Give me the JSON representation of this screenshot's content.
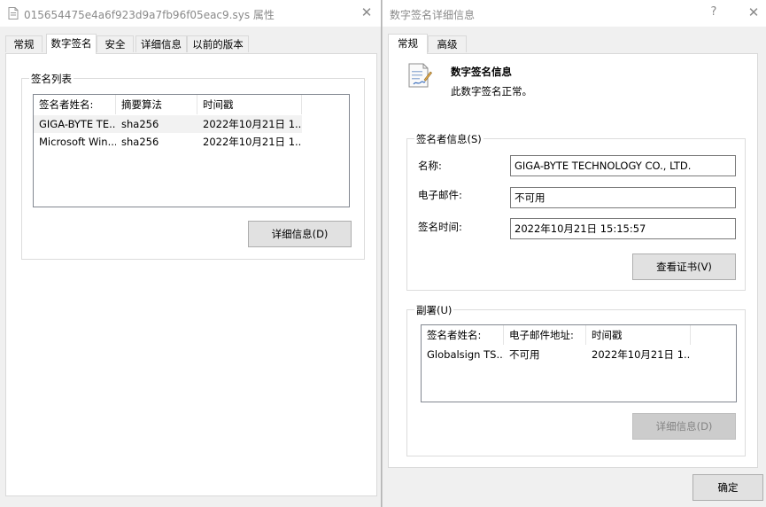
{
  "left_window": {
    "title": "015654475e4a6f923d9a7fb96f05eac9.sys 属性",
    "tabs": [
      {
        "label": "常规"
      },
      {
        "label": "数字签名"
      },
      {
        "label": "安全"
      },
      {
        "label": "详细信息"
      },
      {
        "label": "以前的版本"
      }
    ],
    "active_tab": "数字签名",
    "signature_list": {
      "group_title": "签名列表",
      "columns": [
        "签名者姓名:",
        "摘要算法",
        "时间戳"
      ],
      "rows": [
        {
          "name": "GIGA-BYTE TE...",
          "algorithm": "sha256",
          "timestamp": "2022年10月21日 1..."
        },
        {
          "name": "Microsoft Win...",
          "algorithm": "sha256",
          "timestamp": "2022年10月21日 1..."
        }
      ]
    },
    "details_button": "详细信息(D)"
  },
  "right_window": {
    "title": "数字签名详细信息",
    "help_glyph": "?",
    "tabs": [
      {
        "label": "常规"
      },
      {
        "label": "高级"
      }
    ],
    "active_tab": "常规",
    "info_heading": "数字签名信息",
    "info_status": "此数字签名正常。",
    "signer_group": {
      "title": "签名者信息(S)",
      "name_label": "名称:",
      "name_value": "GIGA-BYTE TECHNOLOGY CO., LTD.",
      "email_label": "电子邮件:",
      "email_value": "不可用",
      "time_label": "签名时间:",
      "time_value": "2022年10月21日 15:15:57"
    },
    "view_cert_button": "查看证书(V)",
    "countersign_group": {
      "title": "副署(U)",
      "columns": [
        "签名者姓名:",
        "电子邮件地址:",
        "时间戳"
      ],
      "rows": [
        {
          "name": "Globalsign TS...",
          "email": "不可用",
          "timestamp": "2022年10月21日 1..."
        }
      ]
    },
    "details_button": "详细信息(D)",
    "ok_button": "确定"
  },
  "icons": {
    "left_title_icon": "file-properties-icon",
    "right_info_icon": "signed-document-icon",
    "close_icon": "close-icon"
  }
}
